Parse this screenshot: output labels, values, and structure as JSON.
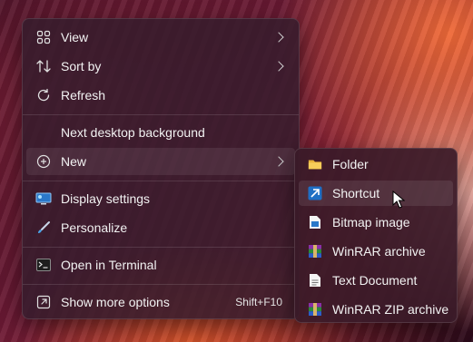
{
  "context_menu": {
    "items": [
      {
        "label": "View",
        "icon": "grid-icon"
      },
      {
        "label": "Sort by",
        "icon": "sort-icon"
      },
      {
        "label": "Refresh",
        "icon": "refresh-icon"
      },
      {
        "label": "Next desktop background"
      },
      {
        "label": "New",
        "icon": "plus-circle-icon"
      },
      {
        "label": "Display settings",
        "icon": "monitor-icon"
      },
      {
        "label": "Personalize",
        "icon": "brush-icon"
      },
      {
        "label": "Open in Terminal",
        "icon": "terminal-icon"
      },
      {
        "label": "Show more options",
        "icon": "expand-icon",
        "shortcut": "Shift+F10"
      }
    ]
  },
  "new_submenu": {
    "items": [
      {
        "label": "Folder",
        "icon": "folder-icon"
      },
      {
        "label": "Shortcut",
        "icon": "shortcut-arrow-icon"
      },
      {
        "label": "Bitmap image",
        "icon": "bitmap-file-icon"
      },
      {
        "label": "WinRAR archive",
        "icon": "winrar-icon"
      },
      {
        "label": "Text Document",
        "icon": "text-file-icon"
      },
      {
        "label": "WinRAR ZIP archive",
        "icon": "winrar-zip-icon"
      }
    ]
  },
  "colors": {
    "accent": "#4aa3e8",
    "folder": "#f4c44d",
    "menu_bg": "#36202c"
  }
}
